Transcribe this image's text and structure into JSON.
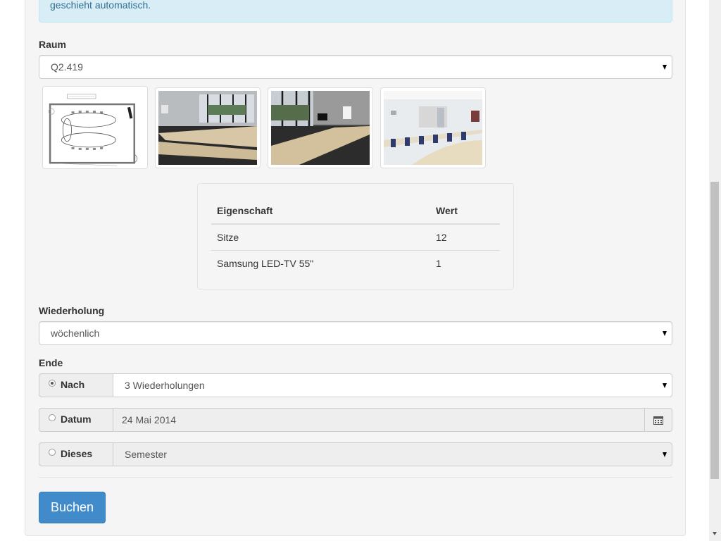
{
  "alert": {
    "text": "geschieht automatisch."
  },
  "raum": {
    "label": "Raum",
    "selected": "Q2.419"
  },
  "thumbnails": [
    {
      "name": "room-floorplan-thumbnail"
    },
    {
      "name": "room-photo-1-thumbnail"
    },
    {
      "name": "room-photo-2-thumbnail"
    },
    {
      "name": "room-photo-3-thumbnail"
    }
  ],
  "properties": {
    "headers": [
      "Eigenschaft",
      "Wert"
    ],
    "rows": [
      [
        "Sitze",
        "12"
      ],
      [
        "Samsung LED-TV 55\"",
        "1"
      ]
    ]
  },
  "wiederholung": {
    "label": "Wiederholung",
    "selected": "wöchenlich"
  },
  "ende": {
    "label": "Ende",
    "nach": {
      "label": "Nach",
      "value": "3 Wiederholungen",
      "checked": true
    },
    "datum": {
      "label": "Datum",
      "value": "24 Mai 2014",
      "checked": false
    },
    "dieses": {
      "label": "Dieses",
      "value": "Semester",
      "checked": false
    }
  },
  "submit": {
    "label": "Buchen"
  },
  "colors": {
    "primary": "#428bca",
    "info_bg": "#d9edf7",
    "info_text": "#31708f"
  }
}
